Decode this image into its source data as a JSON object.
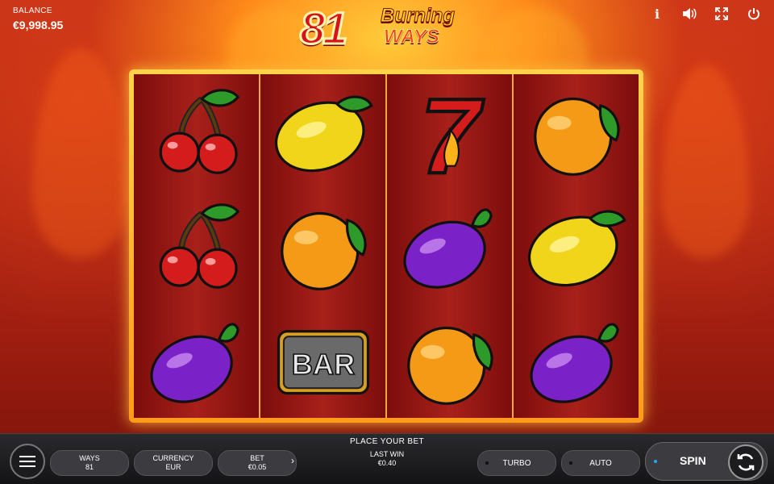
{
  "balance": {
    "label": "BALANCE",
    "value": "€9,998.95"
  },
  "logo": {
    "number": "81",
    "word1": "Burning",
    "word2": "WAYS"
  },
  "top_icons": [
    "info-icon",
    "sound-icon",
    "fullscreen-icon",
    "power-icon"
  ],
  "info_glyph": "i",
  "reels": [
    [
      "cherry",
      "cherry",
      "plum"
    ],
    [
      "lemon",
      "orange",
      "bar"
    ],
    [
      "seven",
      "plum",
      "orange"
    ],
    [
      "orange",
      "lemon",
      "plum"
    ]
  ],
  "bar_symbol_text": "BAR",
  "seven_symbol_text": "7",
  "bottom": {
    "prompt": "PLACE YOUR BET",
    "ways": {
      "label": "WAYS",
      "value": "81"
    },
    "currency": {
      "label": "CURRENCY",
      "value": "EUR"
    },
    "bet": {
      "label": "BET",
      "value": "€0.05",
      "arrow": "›"
    },
    "last_win": {
      "label": "LAST WIN",
      "value": "€0.40"
    },
    "turbo": "TURBO",
    "auto": "AUTO",
    "spin": "SPIN"
  },
  "colors": {
    "frame": "#ffb83a",
    "reel_bg": "#9a1a16",
    "bar_bg": "#2a2a2e",
    "accent": "#29a8ff"
  }
}
